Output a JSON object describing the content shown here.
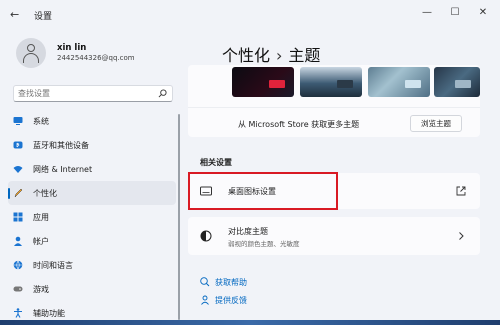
{
  "titlebar": {
    "back_glyph": "←",
    "app_title": "设置",
    "minimize_glyph": "—",
    "maximize_glyph": "☐",
    "close_glyph": "✕"
  },
  "user": {
    "name": "xin lin",
    "email": "2442544326@qq.com"
  },
  "search": {
    "placeholder": "查找设置"
  },
  "nav": {
    "items": [
      {
        "label": "系统",
        "icon": "monitor-icon",
        "color": "#1b74d1"
      },
      {
        "label": "蓝牙和其他设备",
        "icon": "bluetooth-icon",
        "color": "#1b74d1"
      },
      {
        "label": "网络 & Internet",
        "icon": "wifi-icon",
        "color": "#1b74d1"
      },
      {
        "label": "个性化",
        "icon": "pen-icon",
        "color": "#333333"
      },
      {
        "label": "应用",
        "icon": "apps-icon",
        "color": "#1b74d1"
      },
      {
        "label": "帐户",
        "icon": "person-icon",
        "color": "#1b74d1"
      },
      {
        "label": "时间和语言",
        "icon": "globe-icon",
        "color": "#1b74d1"
      },
      {
        "label": "游戏",
        "icon": "gamepad-icon",
        "color": "#777777"
      },
      {
        "label": "辅助功能",
        "icon": "accessibility-icon",
        "color": "#1b74d1"
      }
    ],
    "active_index": 3
  },
  "page": {
    "title_parent": "个性化",
    "separator": "›",
    "title_current": "主题"
  },
  "themes": {
    "store_text": "从 Microsoft Store 获取更多主题",
    "browse_label": "浏览主题"
  },
  "related": {
    "section_label": "相关设置",
    "desktop_icons": {
      "title": "桌面图标设置"
    },
    "contrast": {
      "title": "对比度主题",
      "subtitle": "弱视的颜色主题、光敏度"
    }
  },
  "links": {
    "help": "获取帮助",
    "feedback": "提供反馈"
  },
  "colors": {
    "accent": "#0067c0",
    "highlight": "#d91a24"
  }
}
